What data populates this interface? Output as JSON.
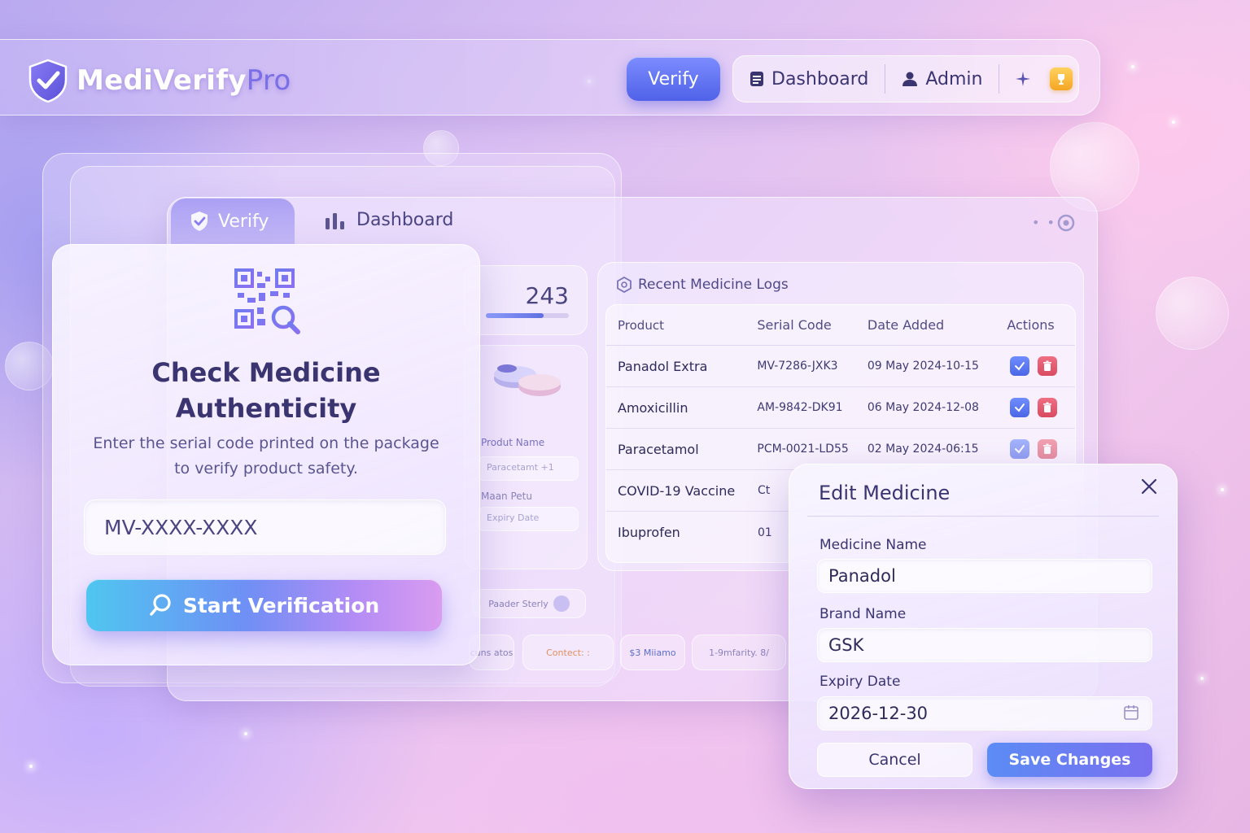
{
  "app": {
    "name": "MediVerify",
    "name_suffix": "Pro"
  },
  "topnav": {
    "verify_label": "Verify",
    "dashboard_label": "Dashboard",
    "admin_label": "Admin"
  },
  "panel": {
    "tabs": [
      {
        "label": "Verify",
        "active": true
      },
      {
        "label": "Dashboard",
        "active": false
      }
    ],
    "stat_value": "243",
    "stat_progress": 0.7
  },
  "ghost_form": {
    "field1_label": "Produt Name",
    "field1_value": "Paracetamt +1",
    "field2_label": "Maan Petu",
    "field3_label": "Expiry Date",
    "link_label": "Paader Sterly"
  },
  "ghost_pills": [
    {
      "label": "cuns atos"
    },
    {
      "label": "Contect: :"
    },
    {
      "label": "$3 Miiamo"
    },
    {
      "label": "1-9mfarity. 8/"
    }
  ],
  "logs": {
    "title": "Recent Medicine Logs",
    "columns": [
      "Product",
      "Serial Code",
      "Date Added",
      "Actions"
    ],
    "rows": [
      {
        "product": "Panadol Extra",
        "serial": "MV-7286-JXK3",
        "date": "09 May 2024-10-15"
      },
      {
        "product": "Amoxicillin",
        "serial": "AM-9842-DK91",
        "date": "06 May 2024-12-08"
      },
      {
        "product": "Paracetamol",
        "serial": "PCM-0021-LD55",
        "date": "02 May 2024-06:15"
      },
      {
        "product": "COVID-19 Vaccine",
        "serial": "Ct",
        "date": ""
      },
      {
        "product": "Ibuprofen",
        "serial": "01",
        "date": ""
      }
    ]
  },
  "verify_card": {
    "title": "Check Medicine Authenticity",
    "subtitle_line1": "Enter the serial code printed on the package",
    "subtitle_line2": "to verify product safety.",
    "input_placeholder": "MV-XXXX-XXXX",
    "button_label": "Start Verification"
  },
  "edit_modal": {
    "title": "Edit Medicine",
    "medicine_name_label": "Medicine Name",
    "medicine_name_value": "Panadol",
    "brand_name_label": "Brand Name",
    "brand_name_value": "GSK",
    "expiry_date_label": "Expiry Date",
    "expiry_date_value": "2026-12-30",
    "cancel_label": "Cancel",
    "save_label": "Save Changes"
  },
  "colors": {
    "accent": "#5f6fe0",
    "danger": "#d94a60",
    "brand_text": "#ffffff",
    "brand_suffix": "#7a6fe6"
  }
}
